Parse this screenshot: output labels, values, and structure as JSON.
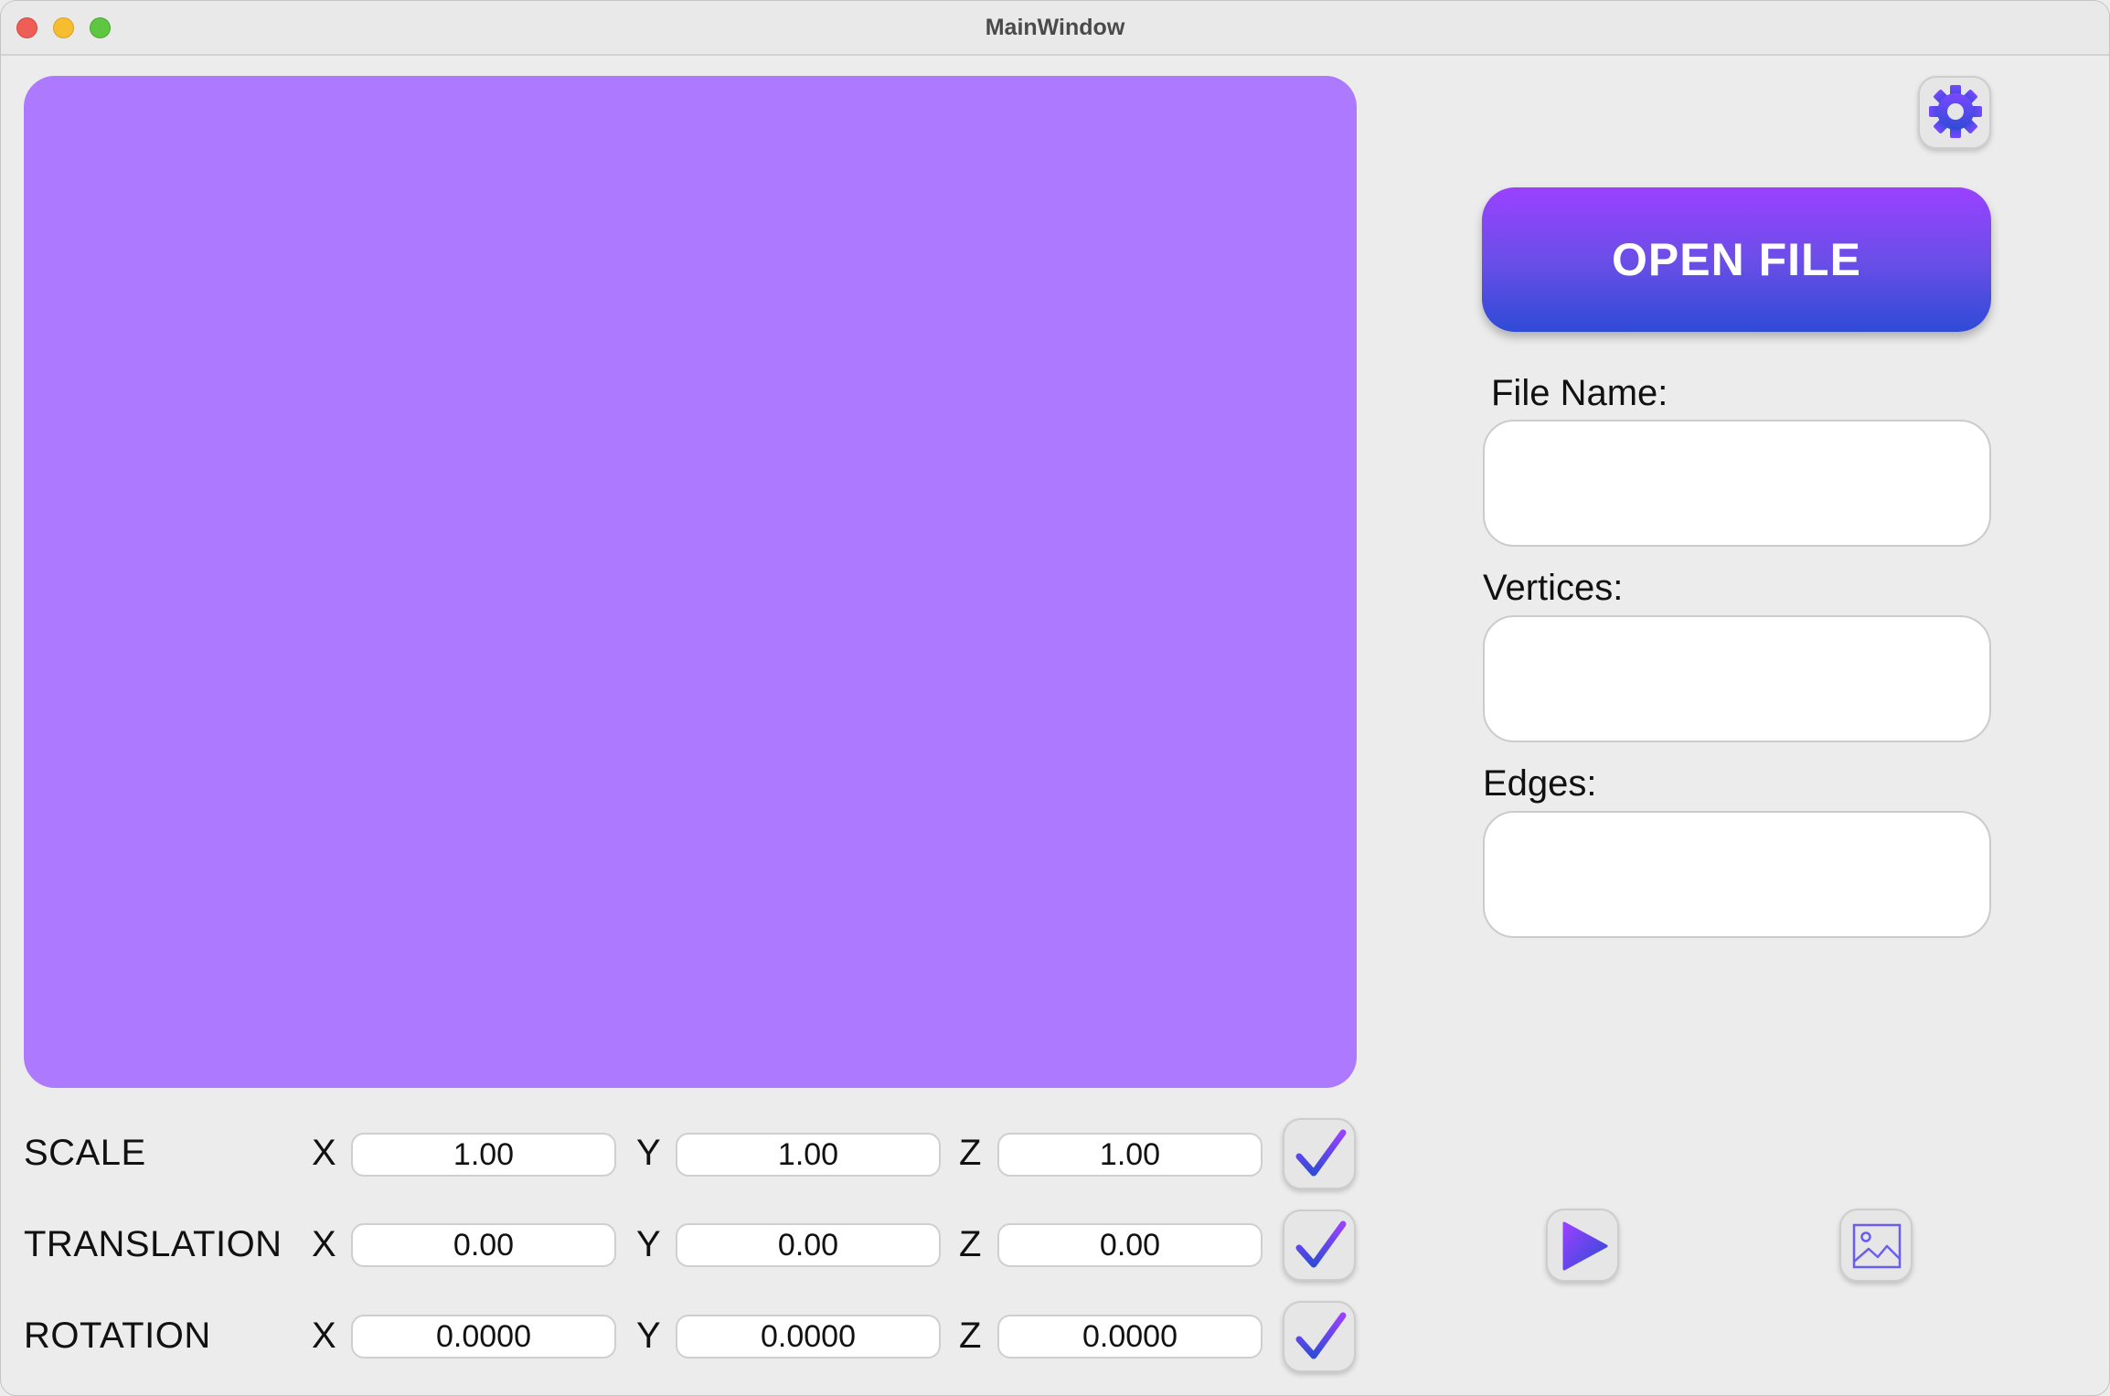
{
  "window": {
    "title": "MainWindow"
  },
  "controls": {
    "axes": {
      "x": "X",
      "y": "Y",
      "z": "Z"
    },
    "rows": [
      {
        "label": "SCALE",
        "x": "1.00",
        "y": "1.00",
        "z": "1.00"
      },
      {
        "label": "TRANSLATION",
        "x": "0.00",
        "y": "0.00",
        "z": "0.00"
      },
      {
        "label": "ROTATION",
        "x": "0.0000",
        "y": "0.0000",
        "z": "0.0000"
      }
    ]
  },
  "sidebar": {
    "open_file_label": "OPEN FILE",
    "file_name_label": "File Name:",
    "file_name_value": "",
    "vertices_label": "Vertices:",
    "vertices_value": "",
    "edges_label": "Edges:",
    "edges_value": ""
  },
  "icons": {
    "settings": "gear-icon",
    "apply": "checkmark-icon",
    "play": "play-icon",
    "screenshot": "image-icon"
  },
  "colors": {
    "viewport": "#ad79ff",
    "accent_top": "#9a41ff",
    "accent_bottom": "#2f4bd6"
  }
}
